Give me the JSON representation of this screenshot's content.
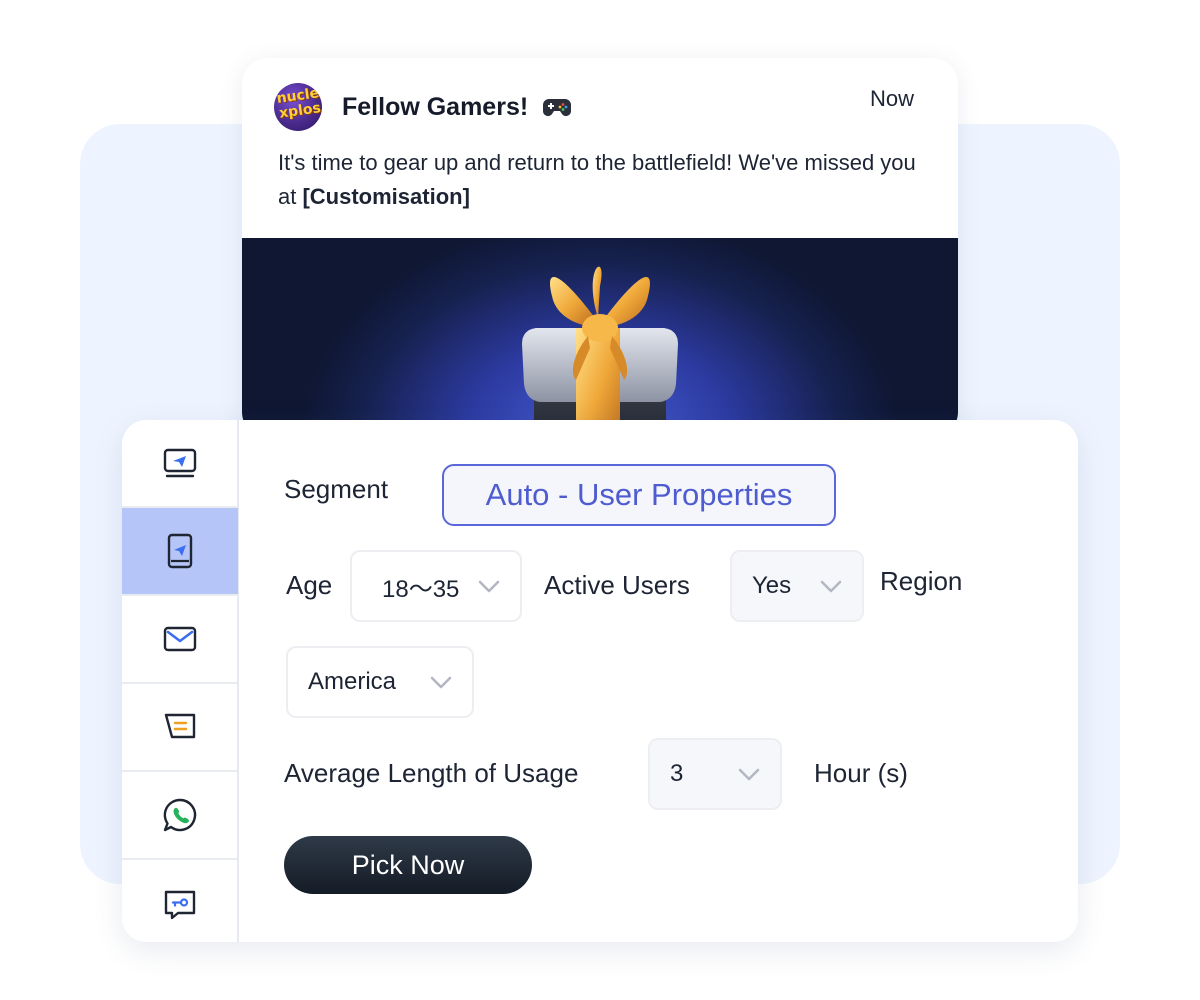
{
  "notification": {
    "avatar_logo_text": "Nuclear Explosion",
    "title": "Fellow Gamers!",
    "title_icon": "gamepad-icon",
    "time": "Now",
    "body_text": "It's time to gear up and return to the battlefield! We've missed you at ",
    "body_highlight": "[Customisation]",
    "banner_image": "gift-box"
  },
  "sidebar": {
    "items": [
      {
        "icon": "desktop-send-icon",
        "active": false
      },
      {
        "icon": "mobile-send-icon",
        "active": true
      },
      {
        "icon": "mail-icon",
        "active": false
      },
      {
        "icon": "sms-icon",
        "active": false
      },
      {
        "icon": "whatsapp-icon",
        "active": false
      },
      {
        "icon": "chat-key-icon",
        "active": false
      }
    ]
  },
  "form": {
    "segment_label": "Segment",
    "segment_value": "Auto - User Properties",
    "age_label": "Age",
    "age_value": "18～35",
    "active_users_label": "Active Users",
    "active_users_value": "Yes",
    "region_label": "Region",
    "region_value": "America",
    "usage_label": "Average Length of Usage",
    "usage_value": "3",
    "usage_unit": "Hour (s)",
    "pick_button": "Pick Now"
  },
  "colors": {
    "accent": "#5a67d8",
    "active_sidebar": "#b6c5f7",
    "background_panel": "#eef4ff",
    "button": "#1c2430"
  }
}
